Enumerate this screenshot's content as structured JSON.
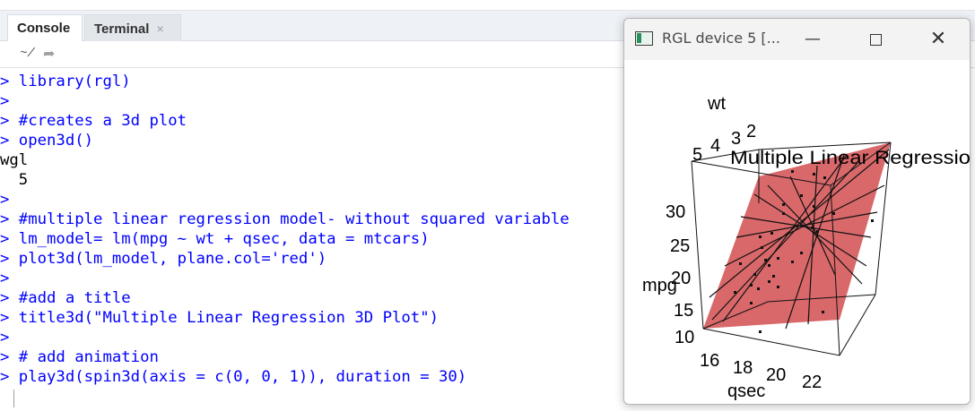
{
  "tabs": {
    "console": "Console",
    "terminal": "Terminal",
    "close_glyph": "×"
  },
  "subbar": {
    "path": "~/",
    "forward_icon": "forward-arrow-icon"
  },
  "console": {
    "prompt_color": "#0000ff",
    "lines": [
      {
        "prompt": ">",
        "text": " library(rgl)"
      },
      {
        "prompt": ">",
        "text": ""
      },
      {
        "prompt": ">",
        "text": " #creates a 3d plot"
      },
      {
        "prompt": ">",
        "text": " open3d()"
      },
      {
        "prompt": "",
        "text": "wgl"
      },
      {
        "prompt": "",
        "text": "  5"
      },
      {
        "prompt": ">",
        "text": ""
      },
      {
        "prompt": ">",
        "text": " #multiple linear regression model- without squared variable"
      },
      {
        "prompt": ">",
        "text": " lm_model= lm(mpg ~ wt + qsec, data = mtcars)"
      },
      {
        "prompt": ">",
        "text": " plot3d(lm_model, plane.col='red')"
      },
      {
        "prompt": ">",
        "text": ""
      },
      {
        "prompt": ">",
        "text": " #add a title"
      },
      {
        "prompt": ">",
        "text": " title3d(\"Multiple Linear Regression 3D Plot\")"
      },
      {
        "prompt": ">",
        "text": ""
      },
      {
        "prompt": ">",
        "text": " # add animation"
      },
      {
        "prompt": ">",
        "text": " play3d(spin3d(axis = c(0, 0, 1)), duration = 30)"
      }
    ]
  },
  "rgl": {
    "title": "RGL device 5 [...",
    "minimize": "—",
    "close": "✕",
    "plot_title": "Multiple Linear Regressio",
    "plane_color": "#d9686a",
    "axes": {
      "wt": {
        "label": "wt",
        "ticks": [
          "5",
          "4",
          "3",
          "2"
        ]
      },
      "mpg": {
        "label": "mpg",
        "ticks": [
          "30",
          "25",
          "20",
          "15",
          "10"
        ]
      },
      "qsec": {
        "label": "qsec",
        "ticks": [
          "16",
          "18",
          "20",
          "22"
        ]
      }
    }
  }
}
